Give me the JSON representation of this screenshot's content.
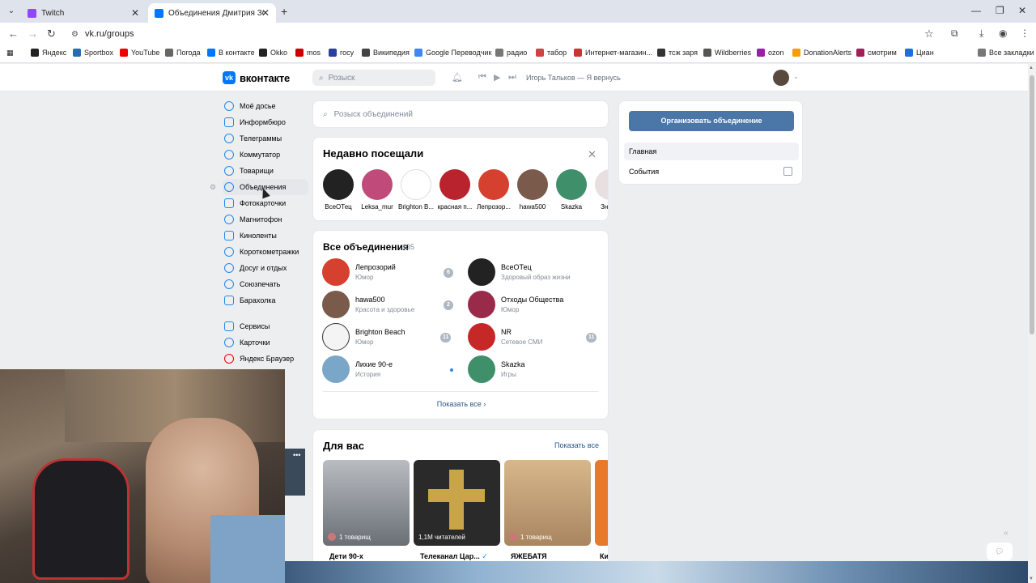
{
  "browser": {
    "tabs": [
      {
        "title": "Twitch",
        "color": "#9146ff"
      },
      {
        "title": "Объединения Дмитрия Зорин",
        "color": "#0077ff"
      }
    ],
    "url": "vk.ru/groups",
    "bookmarks": [
      {
        "label": "Яндекс",
        "color": "#222"
      },
      {
        "label": "Sportbox",
        "color": "#2a6cb0"
      },
      {
        "label": "YouTube",
        "color": "#e00"
      },
      {
        "label": "Погода",
        "color": "#666"
      },
      {
        "label": "В контакте",
        "color": "#0077ff"
      },
      {
        "label": "Okko",
        "color": "#222"
      },
      {
        "label": "mos",
        "color": "#c00"
      },
      {
        "label": "госу",
        "color": "#2a3fa0"
      },
      {
        "label": "Википедия",
        "color": "#444"
      },
      {
        "label": "Google Переводчик",
        "color": "#4285f4"
      },
      {
        "label": "радио",
        "color": "#777"
      },
      {
        "label": "табор",
        "color": "#c44"
      },
      {
        "label": "Интернет-магазин...",
        "color": "#c33"
      },
      {
        "label": "тсж заря",
        "color": "#333"
      },
      {
        "label": "Wildberries",
        "color": "#555"
      },
      {
        "label": "ozon",
        "color": "#9b1fa3"
      },
      {
        "label": "DonationAlerts",
        "color": "#f59e0b"
      },
      {
        "label": "смотрим",
        "color": "#a0205a"
      },
      {
        "label": "Циан",
        "color": "#1f6fd6"
      }
    ],
    "all_bookmarks": "Все закладки"
  },
  "vk": {
    "logo_letter": "vk",
    "brand": "вконтакте",
    "search_placeholder": "Розыск",
    "now_playing": "Игорь Тальков — Я вернусь"
  },
  "leftnav": {
    "items": [
      "Моё досье",
      "Информбюро",
      "Телеграммы",
      "Коммутатор",
      "Товарищи",
      "Объединения",
      "Фотокарточки",
      "Магнитофон",
      "Киноленты",
      "Короткометражки",
      "Досуг и отдых",
      "Союзпечать",
      "Барахолка"
    ],
    "extra": [
      "Сервисы",
      "Карточки",
      "Яндекс Браузер"
    ]
  },
  "main": {
    "search_placeholder": "Розыск объединений",
    "recent": {
      "title": "Недавно посещали",
      "items": [
        {
          "name": "ВсеОТец",
          "color": "#222"
        },
        {
          "name": "Leksa_mur",
          "color": "#c04a7a"
        },
        {
          "name": "Brighton B...",
          "color": "#fff"
        },
        {
          "name": "красная п...",
          "color": "#b8232d"
        },
        {
          "name": "Лепрозор...",
          "color": "#d6402f"
        },
        {
          "name": "hawa500",
          "color": "#7a5a4a"
        },
        {
          "name": "Skazka",
          "color": "#3f8f6a"
        },
        {
          "name": "Знак...",
          "color": "#e8e0e0"
        }
      ]
    },
    "all_groups": {
      "title": "Все объединения",
      "count": "135",
      "groups": [
        {
          "name": "Лепрозорий",
          "sub": "Юмор",
          "badge": "6",
          "color": "#d6402f"
        },
        {
          "name": "ВсеОТец",
          "sub": "Здоровый образ жизни",
          "badge": "",
          "color": "#222"
        },
        {
          "name": "hawa500",
          "sub": "Красота и здоровье",
          "badge": "2",
          "color": "#7a5a4a"
        },
        {
          "name": "Отходы Общества",
          "sub": "Юмор",
          "badge": "",
          "color": "#9a2a4a"
        },
        {
          "name": "Brighton Beach",
          "sub": "Юмор",
          "badge": "11",
          "color": "#f4f4f4"
        },
        {
          "name": "NR",
          "sub": "Сетевое СМИ",
          "badge": "11",
          "color": "#c62828"
        },
        {
          "name": "Лихие 90-е",
          "sub": "История",
          "badge": "",
          "color": "#7aa7c7"
        },
        {
          "name": "Skazka",
          "sub": "Игры",
          "badge": "",
          "color": "#3f8f6a"
        }
      ],
      "show_all": "Показать все"
    },
    "for_you": {
      "title": "Для вас",
      "show_all": "Показать все",
      "items": [
        {
          "name": "Дети 90-х",
          "chip": "1 товарищ",
          "color": "#8a8f96"
        },
        {
          "name": "Телеканал Цар...",
          "chip": "1,1M читателей",
          "color": "#2a2a2a"
        },
        {
          "name": "ЯЖЕБАТЯ",
          "chip": "1 товарищ",
          "color": "#c9a47a"
        },
        {
          "name": "Ки",
          "chip": "",
          "color": "#e8782a"
        }
      ]
    }
  },
  "right": {
    "create_button": "Организовать объединение",
    "menu": [
      "Главная",
      "События"
    ]
  }
}
